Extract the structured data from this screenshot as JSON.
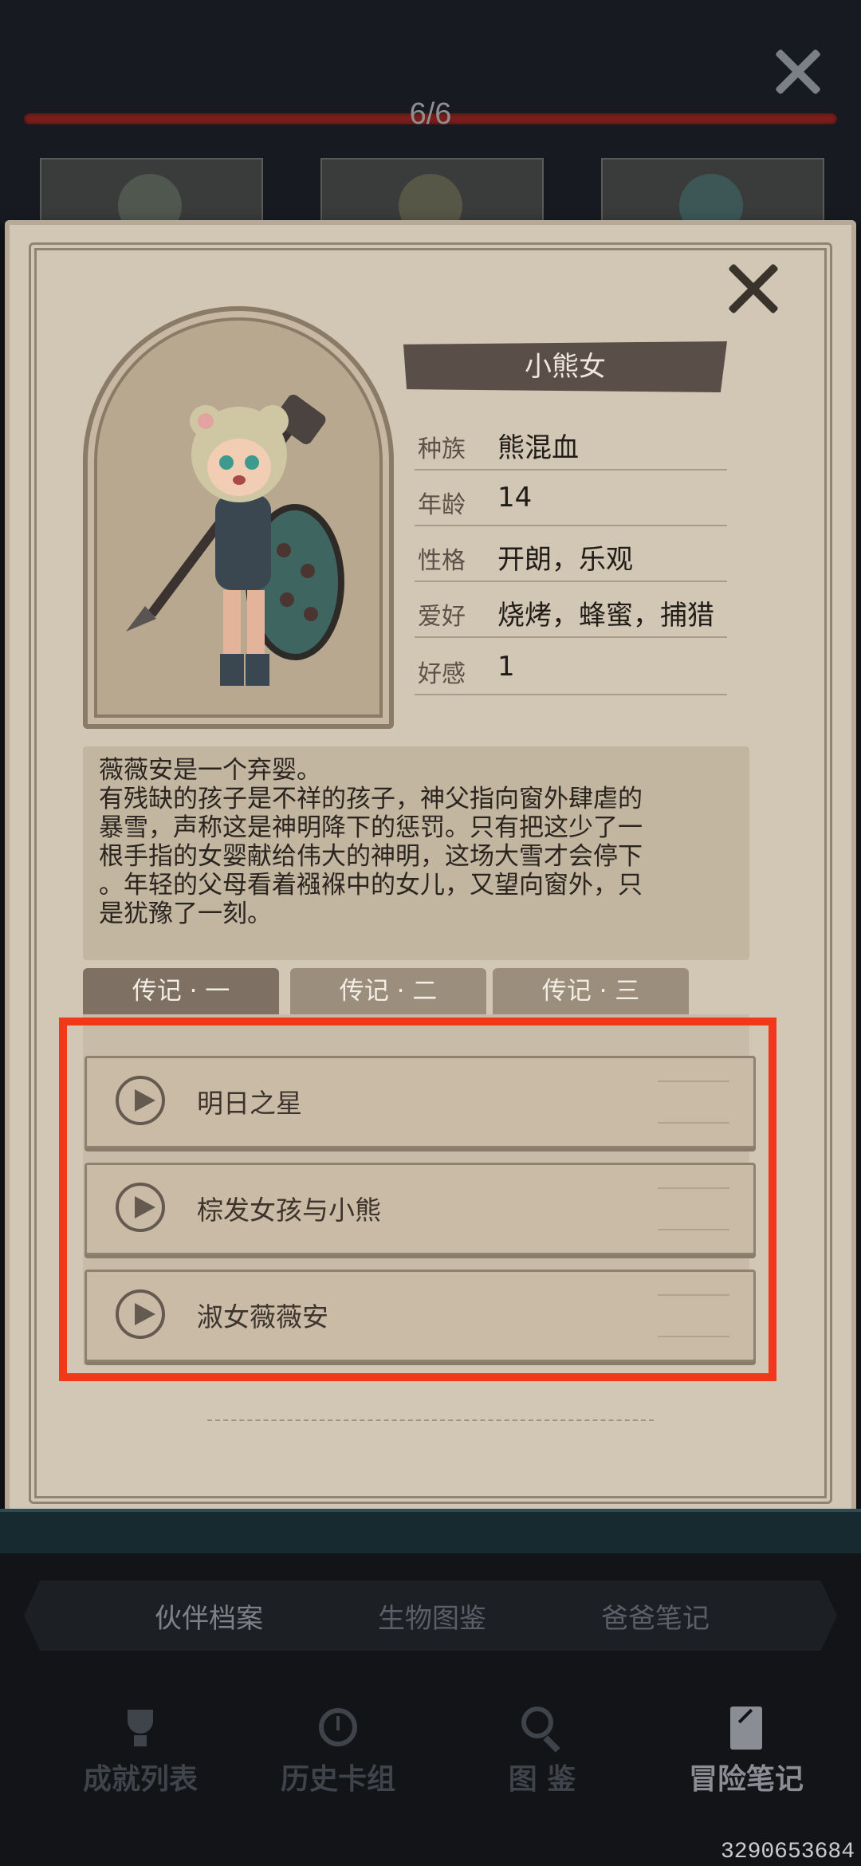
{
  "header": {
    "progress": "6/6",
    "progress_fraction": 1.0
  },
  "character": {
    "name": "小熊女",
    "stats": [
      {
        "label": "种族",
        "value": "熊混血"
      },
      {
        "label": "年龄",
        "value": "14"
      },
      {
        "label": "性格",
        "value": "开朗，乐观"
      },
      {
        "label": "爱好",
        "value": "烧烤，蜂蜜，捕猎"
      },
      {
        "label": "好感",
        "value": "1"
      }
    ]
  },
  "story": {
    "text": "薇薇安是一个弃婴。\n有残缺的孩子是不祥的孩子，神父指向窗外肆虐的\n暴雪，声称这是神明降下的惩罚。只有把这少了一\n根手指的女婴献给伟大的神明，这场大雪才会停下\n。年轻的父母看着襁褓中的女儿，又望向窗外，只\n是犹豫了一刻。"
  },
  "biography_tabs": [
    {
      "label": "传记 · 一",
      "active": true
    },
    {
      "label": "传记 · 二",
      "active": false
    },
    {
      "label": "传记 · 三",
      "active": false
    }
  ],
  "chapters": [
    {
      "title": "明日之星"
    },
    {
      "title": "棕发女孩与小熊"
    },
    {
      "title": "淑女薇薇安"
    }
  ],
  "sub_tabs": [
    {
      "label": "伙伴档案",
      "active": true
    },
    {
      "label": "生物图鉴",
      "active": false
    },
    {
      "label": "爸爸笔记",
      "active": false
    }
  ],
  "bottom_nav": [
    {
      "label": "成就列表",
      "icon": "trophy-icon"
    },
    {
      "label": "历史卡组",
      "icon": "history-icon"
    },
    {
      "label": "图  鉴",
      "icon": "magnifier-icon"
    },
    {
      "label": "冒险笔记",
      "icon": "notebook-icon",
      "active": true
    }
  ],
  "watermark": "3290653684",
  "colors": {
    "highlight": "#f2381b",
    "progress": "#7a1f1e",
    "page": "#d2c7b5"
  }
}
